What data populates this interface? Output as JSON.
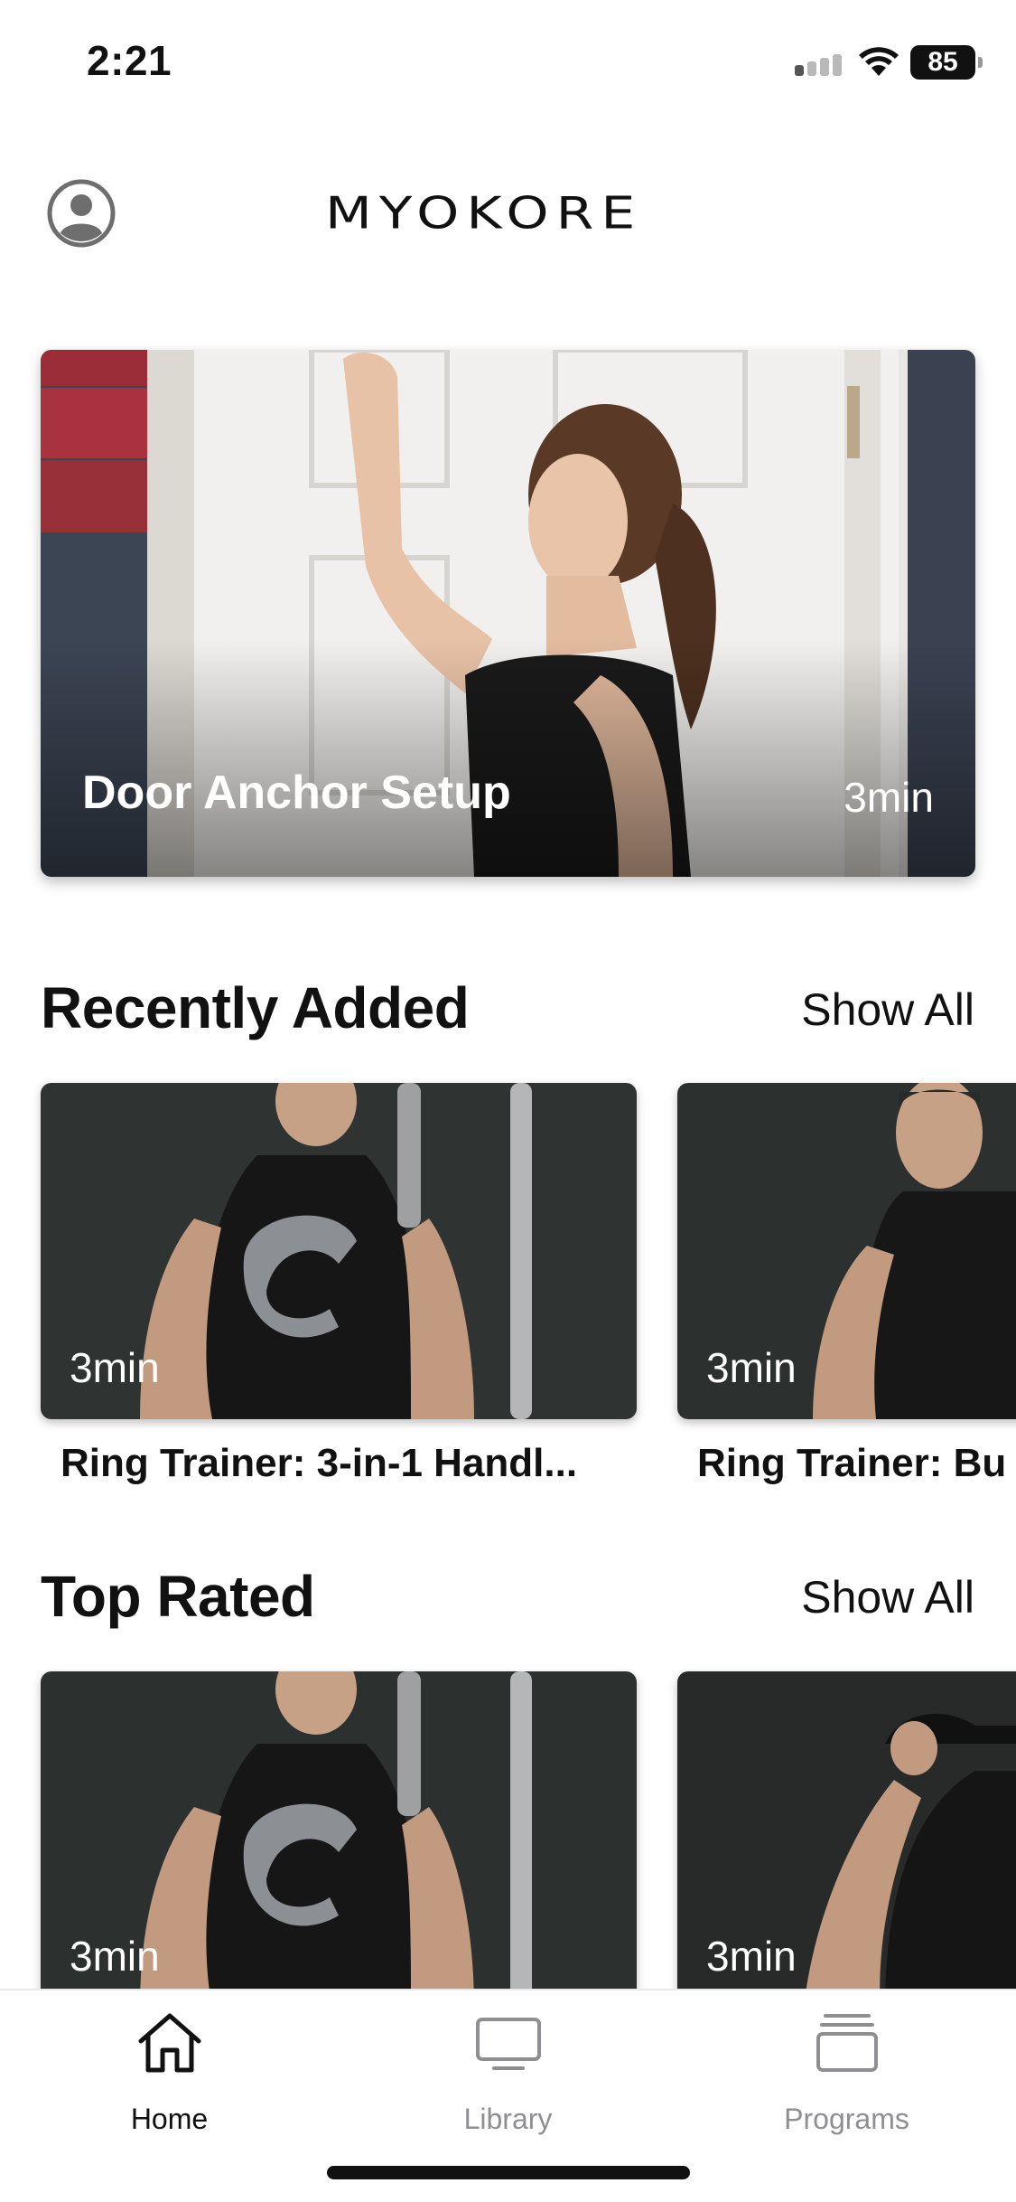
{
  "status_bar": {
    "time": "2:21",
    "battery": "85"
  },
  "header": {
    "logo_text": "MYOKORE",
    "profile_icon": "person-circle-icon"
  },
  "hero": {
    "title": "Door Anchor Setup",
    "duration": "3min"
  },
  "sections": {
    "recently_added": {
      "title": "Recently Added",
      "show_all": "Show All",
      "items": [
        {
          "duration": "3min",
          "title": "Ring Trainer: 3-in-1 Handl..."
        },
        {
          "duration": "3min",
          "title": "Ring Trainer: Bu"
        }
      ]
    },
    "top_rated": {
      "title": "Top Rated",
      "show_all": "Show All",
      "items": [
        {
          "duration": "3min"
        },
        {
          "duration": "3min"
        }
      ]
    }
  },
  "tabbar": {
    "tabs": [
      {
        "label": "Home",
        "icon": "house-icon",
        "active": true
      },
      {
        "label": "Library",
        "icon": "tv-icon",
        "active": false
      },
      {
        "label": "Programs",
        "icon": "stack-icon",
        "active": false
      }
    ],
    "active_color": "#111111",
    "inactive_color": "#8e8e93"
  }
}
